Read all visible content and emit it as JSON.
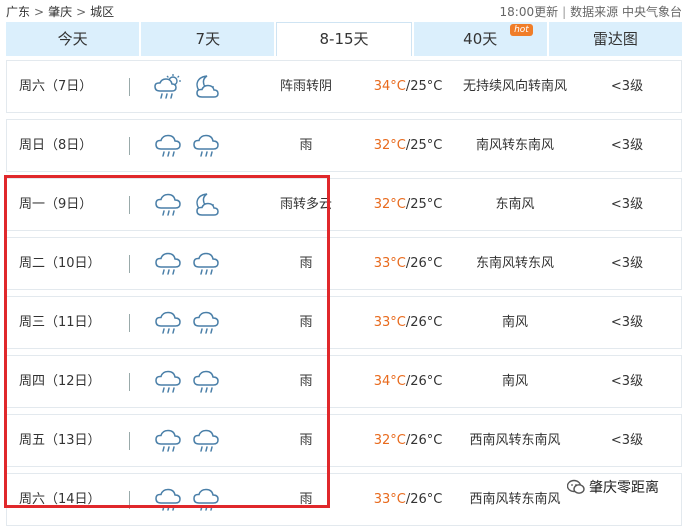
{
  "breadcrumb": {
    "province": "广东",
    "city": "肇庆",
    "district": "城区"
  },
  "meta": {
    "update_time": "18:00更新",
    "source": "数据来源 中央气象台"
  },
  "tabs": [
    {
      "label": "今天",
      "badge": ""
    },
    {
      "label": "7天",
      "badge": ""
    },
    {
      "label": "8-15天",
      "badge": "",
      "active": true
    },
    {
      "label": "40天",
      "badge": "hot"
    },
    {
      "label": "雷达图",
      "badge": ""
    }
  ],
  "forecast": [
    {
      "day": "周六（7日）",
      "icon_day": "showers-sun-icon",
      "icon_night": "cloudy-moon-icon",
      "desc": "阵雨转阴",
      "high": "34°C",
      "low": "/25°C",
      "wind": "无持续风向转南风",
      "level": "<3级"
    },
    {
      "day": "周日（8日）",
      "icon_day": "rain-icon",
      "icon_night": "rain-icon",
      "desc": "雨",
      "high": "32°C",
      "low": "/25°C",
      "wind": "南风转东南风",
      "level": "<3级"
    },
    {
      "day": "周一（9日）",
      "icon_day": "rain-icon",
      "icon_night": "cloudy-moon-icon",
      "desc": "雨转多云",
      "high": "32°C",
      "low": "/25°C",
      "wind": "东南风",
      "level": "<3级"
    },
    {
      "day": "周二（10日）",
      "icon_day": "rain-icon",
      "icon_night": "rain-icon",
      "desc": "雨",
      "high": "33°C",
      "low": "/26°C",
      "wind": "东南风转东风",
      "level": "<3级"
    },
    {
      "day": "周三（11日）",
      "icon_day": "rain-icon",
      "icon_night": "rain-icon",
      "desc": "雨",
      "high": "33°C",
      "low": "/26°C",
      "wind": "南风",
      "level": "<3级"
    },
    {
      "day": "周四（12日）",
      "icon_day": "rain-icon",
      "icon_night": "rain-icon",
      "desc": "雨",
      "high": "34°C",
      "low": "/26°C",
      "wind": "南风",
      "level": "<3级"
    },
    {
      "day": "周五（13日）",
      "icon_day": "rain-icon",
      "icon_night": "rain-icon",
      "desc": "雨",
      "high": "32°C",
      "low": "/26°C",
      "wind": "西南风转东南风",
      "level": "<3级"
    },
    {
      "day": "周六（14日）",
      "icon_day": "rain-icon",
      "icon_night": "rain-icon",
      "desc": "雨",
      "high": "33°C",
      "low": "/26°C",
      "wind": "西南风转东南风",
      "level": ""
    }
  ],
  "watermark": {
    "text": "肇庆零距离"
  },
  "colors": {
    "tab_bg": "#dbeffc",
    "high_temp": "#e86a1d",
    "highlight_box": "#e0282b",
    "icon": "#4a7fa8"
  }
}
